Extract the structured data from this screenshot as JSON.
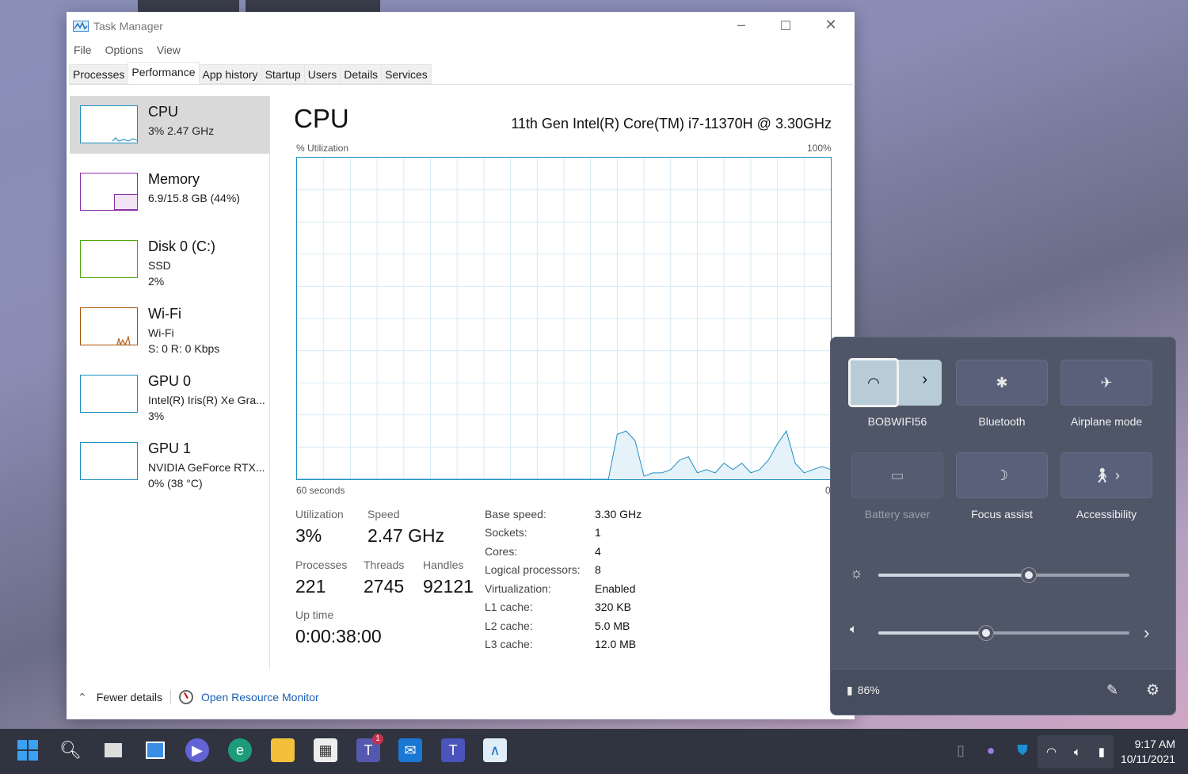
{
  "window": {
    "title": "Task Manager",
    "menu": [
      "File",
      "Options",
      "View"
    ],
    "tabs": [
      "Processes",
      "Performance",
      "App history",
      "Startup",
      "Users",
      "Details",
      "Services"
    ],
    "active_tab": "Performance"
  },
  "sidebar": [
    {
      "name": "CPU",
      "lines": [
        "3% 2.47 GHz"
      ],
      "color": "#1e8fc0"
    },
    {
      "name": "Memory",
      "lines": [
        "6.9/15.8 GB (44%)"
      ],
      "color": "#8b2fa7"
    },
    {
      "name": "Disk 0 (C:)",
      "lines": [
        "SSD",
        "2%"
      ],
      "color": "#4da60c"
    },
    {
      "name": "Wi-Fi",
      "lines": [
        "Wi-Fi",
        "S: 0 R: 0 Kbps"
      ],
      "color": "#a74f01"
    },
    {
      "name": "GPU 0",
      "lines": [
        "Intel(R) Iris(R) Xe Gra...",
        "3%"
      ],
      "color": "#1e8fc0"
    },
    {
      "name": "GPU 1",
      "lines": [
        "NVIDIA GeForce RTX...",
        "0% (38 °C)"
      ],
      "color": "#1e8fc0"
    }
  ],
  "main": {
    "title": "CPU",
    "cpu_model": "11th Gen Intel(R) Core(TM) i7-11370H @ 3.30GHz",
    "graph_label": "% Utilization",
    "graph_max": "100%",
    "graph_time": "60 seconds",
    "graph_min": "0",
    "utilization_series": [
      0,
      0,
      0,
      0,
      0,
      0,
      0,
      0,
      0,
      0,
      0,
      0,
      0,
      0,
      0,
      0,
      0,
      0,
      0,
      0,
      0,
      0,
      0,
      0,
      0,
      0,
      0,
      0,
      0,
      0,
      0,
      0,
      0,
      0,
      0,
      0,
      14,
      15,
      12,
      1,
      2,
      2,
      3,
      6,
      7,
      2,
      3,
      2,
      5,
      3,
      5,
      2,
      3,
      6,
      11,
      15,
      5,
      2,
      3,
      4,
      3
    ],
    "stats": {
      "utilization_label": "Utilization",
      "utilization": "3%",
      "speed_label": "Speed",
      "speed": "2.47 GHz",
      "processes_label": "Processes",
      "processes": "221",
      "threads_label": "Threads",
      "threads": "2745",
      "handles_label": "Handles",
      "handles": "92121",
      "uptime_label": "Up time",
      "uptime": "0:00:38:00"
    },
    "specs": [
      [
        "Base speed:",
        "3.30 GHz"
      ],
      [
        "Sockets:",
        "1"
      ],
      [
        "Cores:",
        "4"
      ],
      [
        "Logical processors:",
        "8"
      ],
      [
        "Virtualization:",
        "Enabled"
      ],
      [
        "L1 cache:",
        "320 KB"
      ],
      [
        "L2 cache:",
        "5.0 MB"
      ],
      [
        "L3 cache:",
        "12.0 MB"
      ]
    ]
  },
  "footer": {
    "fewer": "Fewer details",
    "monitor": "Open Resource Monitor"
  },
  "quick_settings": {
    "tiles": [
      "BOBWIFI56",
      "Bluetooth",
      "Airplane mode",
      "Battery saver",
      "Focus assist",
      "Accessibility"
    ],
    "brightness": 0.6,
    "volume": 0.43,
    "battery": "86%"
  },
  "taskbar": {
    "time": "9:17 AM",
    "date": "10/11/2021",
    "teams_badge": "1"
  }
}
